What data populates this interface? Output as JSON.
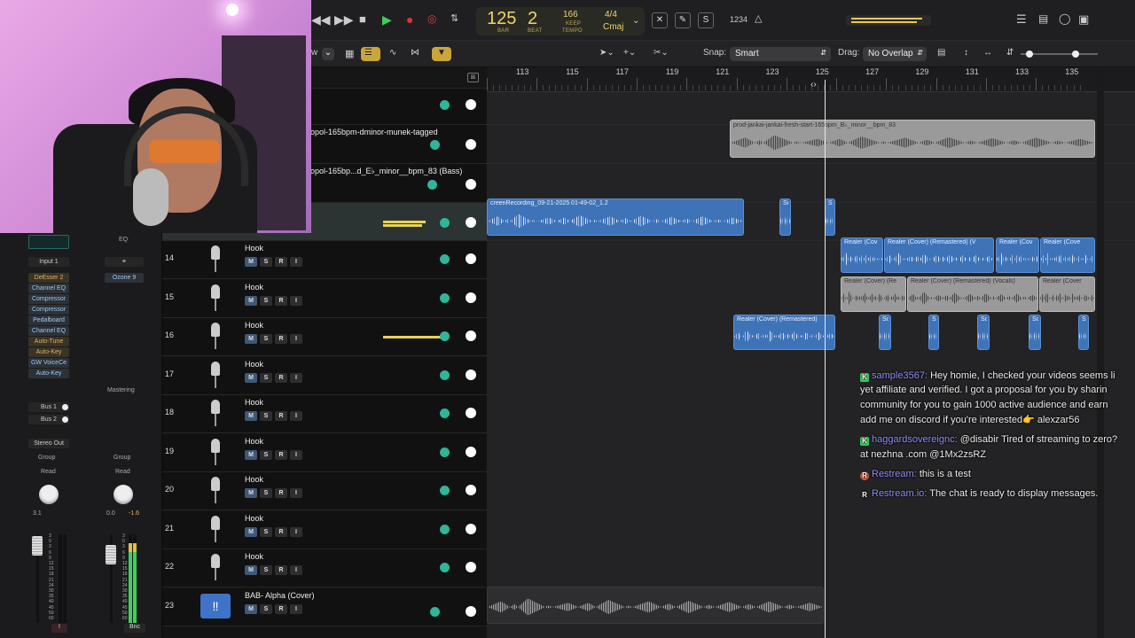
{
  "transport": {
    "bar": "125",
    "beat": "2",
    "bar_label": "BAR",
    "beat_label": "BEAT",
    "tempo": "166",
    "keep_label": "KEEP",
    "tempo_label": "TEMPO",
    "signature": "4/4",
    "key": "Cmaj",
    "count_label": "1234"
  },
  "toolbar": {
    "view_label": "w",
    "snap_label": "Snap:",
    "snap_value": "Smart",
    "drag_label": "Drag:",
    "drag_value": "No Overlap"
  },
  "ruler": {
    "bars": [
      "113",
      "115",
      "117",
      "119",
      "121",
      "123",
      "125",
      "127",
      "129",
      "131",
      "133",
      "135"
    ]
  },
  "inspector": {
    "eq_label": "EQ",
    "input_label": "Input 1",
    "plugins": [
      "DeEsser 2",
      "Channel EQ",
      "Compressor",
      "Compressor",
      "Pedalboard",
      "Channel EQ",
      "Auto-Tune",
      "Auto-Key",
      "GW VoiceCe",
      "Auto-Key"
    ],
    "ozone": "Ozone 9",
    "mastering": "Mastering",
    "bus1": "Bus 1",
    "bus2": "Bus 2",
    "stereo_out": "Stereo Out",
    "group_left": "Group",
    "group_right": "Group",
    "read_left": "Read",
    "read_right": "Read",
    "pan_left": "3.1",
    "vol_right": "0.0",
    "peak_right": "-1.6",
    "bnc": "Bnc",
    "meter_scale": [
      "3",
      "0",
      "3",
      "6",
      "9",
      "12",
      "15",
      "18",
      "21",
      "24",
      "30",
      "35",
      "40",
      "45",
      "50",
      "60"
    ]
  },
  "tracks_top": [
    {
      "name": ""
    },
    {
      "name": "opol-165bpm-dminor-munek-tagged"
    },
    {
      "name": "opol-165bp...d_E♭_minor__bpm_83 (Bass)"
    },
    {
      "name": ""
    }
  ],
  "tracks": [
    {
      "num": "14",
      "name": "Hook"
    },
    {
      "num": "15",
      "name": "Hook"
    },
    {
      "num": "16",
      "name": "Hook"
    },
    {
      "num": "17",
      "name": "Hook"
    },
    {
      "num": "18",
      "name": "Hook"
    },
    {
      "num": "19",
      "name": "Hook"
    },
    {
      "num": "20",
      "name": "Hook"
    },
    {
      "num": "21",
      "name": "Hook"
    },
    {
      "num": "22",
      "name": "Hook"
    },
    {
      "num": "23",
      "name": "BAB- Alpha (Cover)"
    }
  ],
  "buttons": {
    "m": "M",
    "s": "S",
    "r": "R",
    "i": "I"
  },
  "regions": {
    "beat": "prod-jankai-jankai-fresh-start-165bpm_B♭_minor__bpm_83",
    "screen": "creenRecording_09-21-2025 01-49-02_1.2",
    "sc": "Sc",
    "s": "S",
    "realer1": "Realer (Cov",
    "realer2": "Realer (Cover) (Remastered) (V",
    "realer3": "Realer (Cov",
    "realer4": "Realer (Cove",
    "realer5": "Realer (Cover) (Re",
    "realer6": "Realer (Cover) (Remastered) (Vocals)",
    "realer7": "Realer (Cover",
    "realer8": "Realer (Cover) (Remastered)",
    "sc2": "Sc",
    "s2": "S",
    "sc3": "Sc",
    "sc4": "Sc",
    "s3": "S"
  },
  "chat": [
    {
      "user": "sample3567:",
      "text_lines": [
        "Hey homie, I checked your videos seems li",
        "yet affiliate and verified. I got a proposal for you by sharin",
        "community for you to gain 1000 active audience and earn",
        "add me on discord if you're interested👉 alexzar56"
      ]
    },
    {
      "user": "haggardsovereignc:",
      "text_lines": [
        "@disabir Tired of streaming to zero?",
        "at nezhna .com @1Mx2zsRZ"
      ]
    },
    {
      "user": "Restream:",
      "text_lines": [
        "this is a test"
      ]
    },
    {
      "user": "Restream.io:",
      "text_lines": [
        "The chat is ready to display messages."
      ]
    }
  ],
  "colors": {
    "accent_green": "#2fb59a",
    "region_blue": "#3e73b8",
    "lcd_text": "#f0d46a",
    "chat_user": "#8f8ff8"
  }
}
